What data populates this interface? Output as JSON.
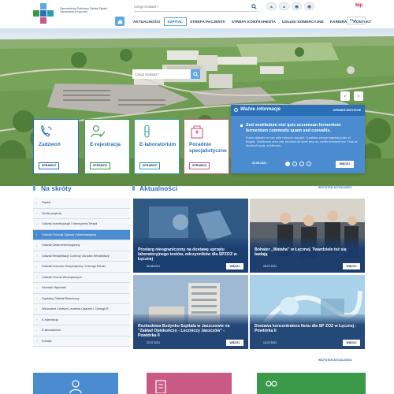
{
  "header": {
    "logo_text": "Samodzielny Publiczny Zakład Opieki Zdrowotnej w Łęcznej",
    "search_placeholder": "Czego szukasz?",
    "accessibility": [
      "A",
      "A",
      "👁",
      "👁"
    ],
    "bip": "bip",
    "nav": [
      "AKTUALNOŚCI",
      "SZPITAL",
      "STREFA PACJENTA",
      "STREFA KONTRAHENTA",
      "USŁUGI KOMERCYJNE",
      "KARIERA",
      "KONTAKT"
    ],
    "nav_active_index": 1,
    "lang": "PL"
  },
  "hero": {
    "search_placeholder": "Czego szukasz?"
  },
  "tiles": [
    {
      "label": "Zadzwoń",
      "button": "SPRAWDŹ",
      "color": "#2b6fb6"
    },
    {
      "label": "E-rejestracja",
      "button": "SPRAWDŹ",
      "color": "#3a9a4a"
    },
    {
      "label": "E-laboratorium",
      "button": "SPRAWDŹ",
      "color": "#2ca0a8"
    },
    {
      "label": "Poradnie specjalistyczne",
      "button": "SPRAWDŹ",
      "color": "#c95a86"
    }
  ],
  "info": {
    "title": "Ważne informacje",
    "all_label": "SPRAWDŹ WSZYSTKIE",
    "lead": "Sed vestibulum nisl quis accumsan fermentum fermentum commodo quam sed convallis.",
    "text": "Fusce aliquam mi nec ante rhoncus suscipit. Curabitur semper egestas justo et feugiat. Vestibulum nunc nisi, tincidunt sit amet arcu ac, mollis hendrerit nisl. Duis at tincidunt turpis, id bibendu.",
    "date": "03.08.2021",
    "more": "WIĘCEJ",
    "dots": 4,
    "active_dot": 0
  },
  "shortcuts": {
    "title": "Na skróty",
    "items": [
      "Szpital",
      "Strefa pacjenta",
      "Oddział Anestezjologii i Intensywnej Terapii",
      "Oddział Chirurgii Ogólnej i Małoinwazyjnej",
      "Oddział Gastroenterologiczny",
      "Oddział Rehabilitacji i Dzienny Ośrodek Rehabilitacji",
      "Oddział Urazowo-Ortopedyczny i Chirurgii Rehab.",
      "Oddział Chorób Wewnętrznych",
      "Ośrodek Hiperbarii",
      "Szpitalny Oddział Ratunkowy",
      "Wschodnie Centrum Leczenia Oparzeń i Chirurgii R.",
      "E-rejestracja",
      "E-laboratorium",
      "Kontakt"
    ],
    "active_index": 3
  },
  "news": {
    "title": "Aktualności",
    "all_label": "WSZYSTKIE AKTUALNOŚCI",
    "cards": [
      {
        "title": "Przetarg nieograniczony na dostawę sprzętu laboratoryjnego testów, odczynników dla SPZOZ w Łęcznej",
        "date": "05.08.2021",
        "more": "WIĘCEJ"
      },
      {
        "title": "Bohater „Wataha” w Łęcznej. Twardziele też się badają",
        "date": "28.07.2021",
        "more": "WIĘCEJ"
      },
      {
        "title": "Rozbudowa Budynku Szpitala w Jaszczowie na \"Zakład Opiekuńczo - Leczniczy Jaszczów\" - Powtórka II",
        "date": "22.07.2021",
        "more": "WIĘCEJ"
      },
      {
        "title": "Dostawa koncentratora tlenu dla SP ZOZ w Łęcznej - Powtórka II",
        "date": "13.07.2021",
        "more": "WIĘCEJ"
      }
    ]
  },
  "colors": {
    "accent": "#2b6fb6",
    "light_accent": "#5fa8e8",
    "info_bg": "#4b8cd0"
  }
}
